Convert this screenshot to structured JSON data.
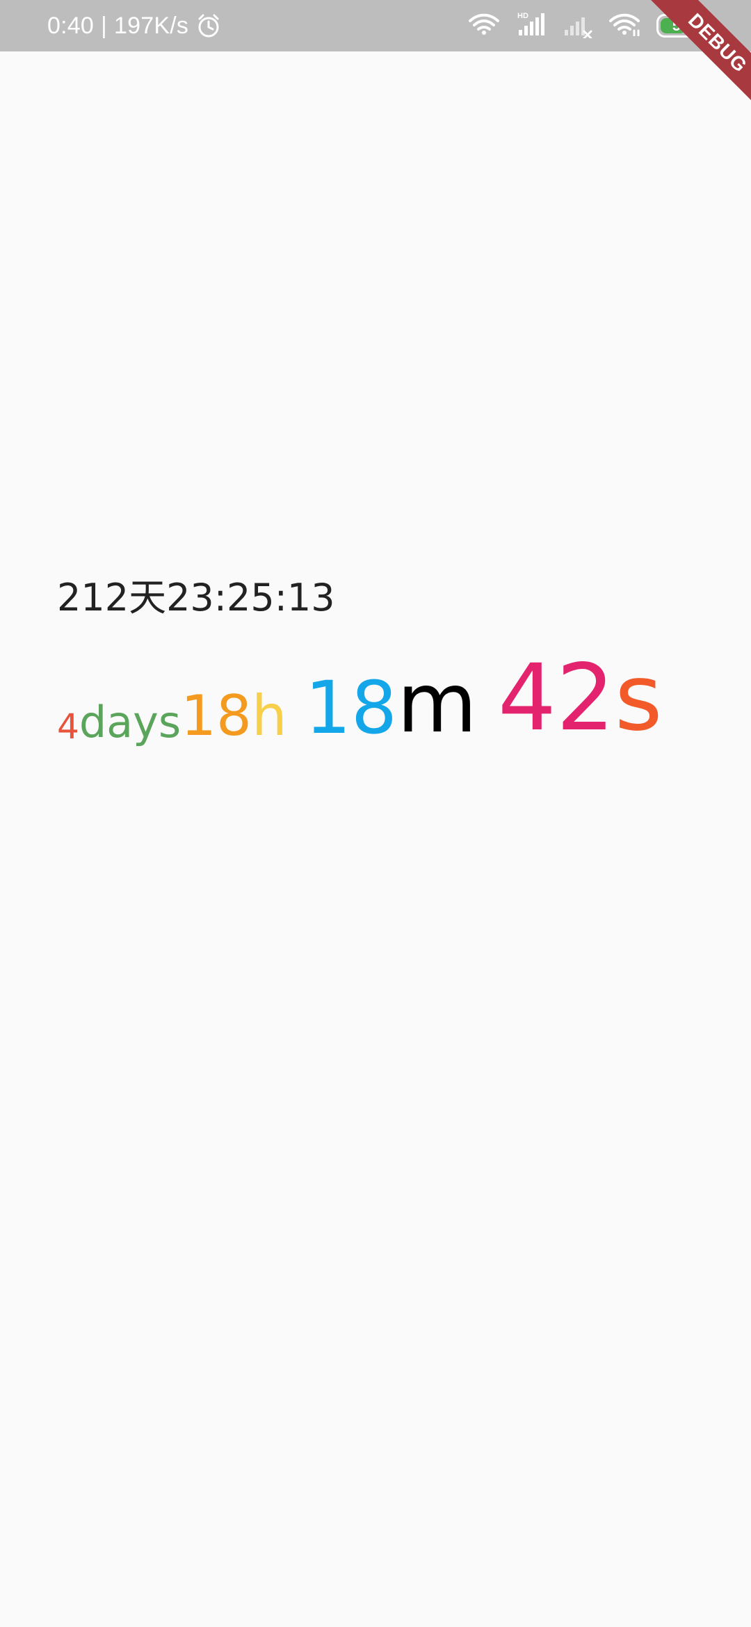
{
  "status_bar": {
    "time": "0:40",
    "separator": "|",
    "network_speed": "197K/s",
    "icons": [
      "alarm-icon",
      "wifi-icon",
      "hd-signal-icon",
      "signal-off-icon",
      "wifi-hotspot-icon",
      "battery-icon"
    ],
    "hd_label": "HD",
    "battery_percent": "53"
  },
  "debug_banner": {
    "label": "DEBUG"
  },
  "content": {
    "countdown_text": "212天23:25:13",
    "rich_countdown": {
      "days_value": "4",
      "days_unit": "days",
      "hours_value": "18",
      "hours_unit": "h",
      "minutes_value": "18",
      "minutes_unit": "m",
      "seconds_value": "42",
      "seconds_unit": "s"
    }
  },
  "colors": {
    "days_value": "#E8533C",
    "days_unit": "#5BA45B",
    "hours_value": "#F39A1F",
    "hours_unit": "#F7CF4A",
    "minutes_value": "#13A6E8",
    "minutes_unit": "#000000",
    "seconds_value": "#E4236F",
    "seconds_unit": "#F25A2A",
    "status_bar_bg": "#BDBDBD",
    "page_bg": "#FAFAFA",
    "debug_ribbon": "#A83A3F"
  }
}
